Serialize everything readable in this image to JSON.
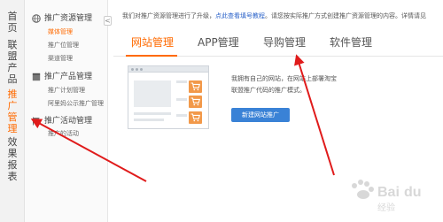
{
  "left_nav": {
    "items": [
      {
        "chars": [
          "首",
          "页"
        ],
        "active": false
      },
      {
        "chars": [
          "联",
          "盟",
          "产",
          "品"
        ],
        "active": false
      },
      {
        "chars": [
          "推",
          "广",
          "管",
          "理"
        ],
        "active": true
      },
      {
        "chars": [
          "效",
          "果",
          "报",
          "表"
        ],
        "active": false
      }
    ]
  },
  "sidebar": {
    "collapse_glyph": "<",
    "sections": [
      {
        "title": "推广资源管理",
        "icon": "globe-icon",
        "items": [
          {
            "label": "媒体管理",
            "active": true
          },
          {
            "label": "推广位管理",
            "active": false
          },
          {
            "label": "渠道管理",
            "active": false
          }
        ]
      },
      {
        "title": "推广产品管理",
        "icon": "box-icon",
        "items": [
          {
            "label": "推广计划管理",
            "active": false
          },
          {
            "label": "阿里妈公示推广管理",
            "active": false
          }
        ]
      },
      {
        "title": "推广活动管理",
        "icon": "flag-icon",
        "items": [
          {
            "label": "推广的活动",
            "active": false
          }
        ]
      }
    ]
  },
  "notice": {
    "prefix": "我们对推广资源管理进行了升级，",
    "link": "点此查看填号教程",
    "suffix": "。请您按实际推广方式创建推广资源管理的内容。详情请见"
  },
  "tabs": [
    {
      "label": "网站管理",
      "active": true
    },
    {
      "label": "APP管理",
      "active": false
    },
    {
      "label": "导购管理",
      "active": false
    },
    {
      "label": "软件管理",
      "active": false
    }
  ],
  "content": {
    "desc_line1": "我拥有自己的网站，在网站上部署淘宝",
    "desc_line2": "联盟推广代码的推广模式。",
    "new_button": "新建网站推广"
  },
  "colors": {
    "accent": "#ff6a00",
    "link": "#2a62c9",
    "button": "#3a82d6",
    "arrow": "#e01b1b",
    "cart": "#f2994a"
  }
}
